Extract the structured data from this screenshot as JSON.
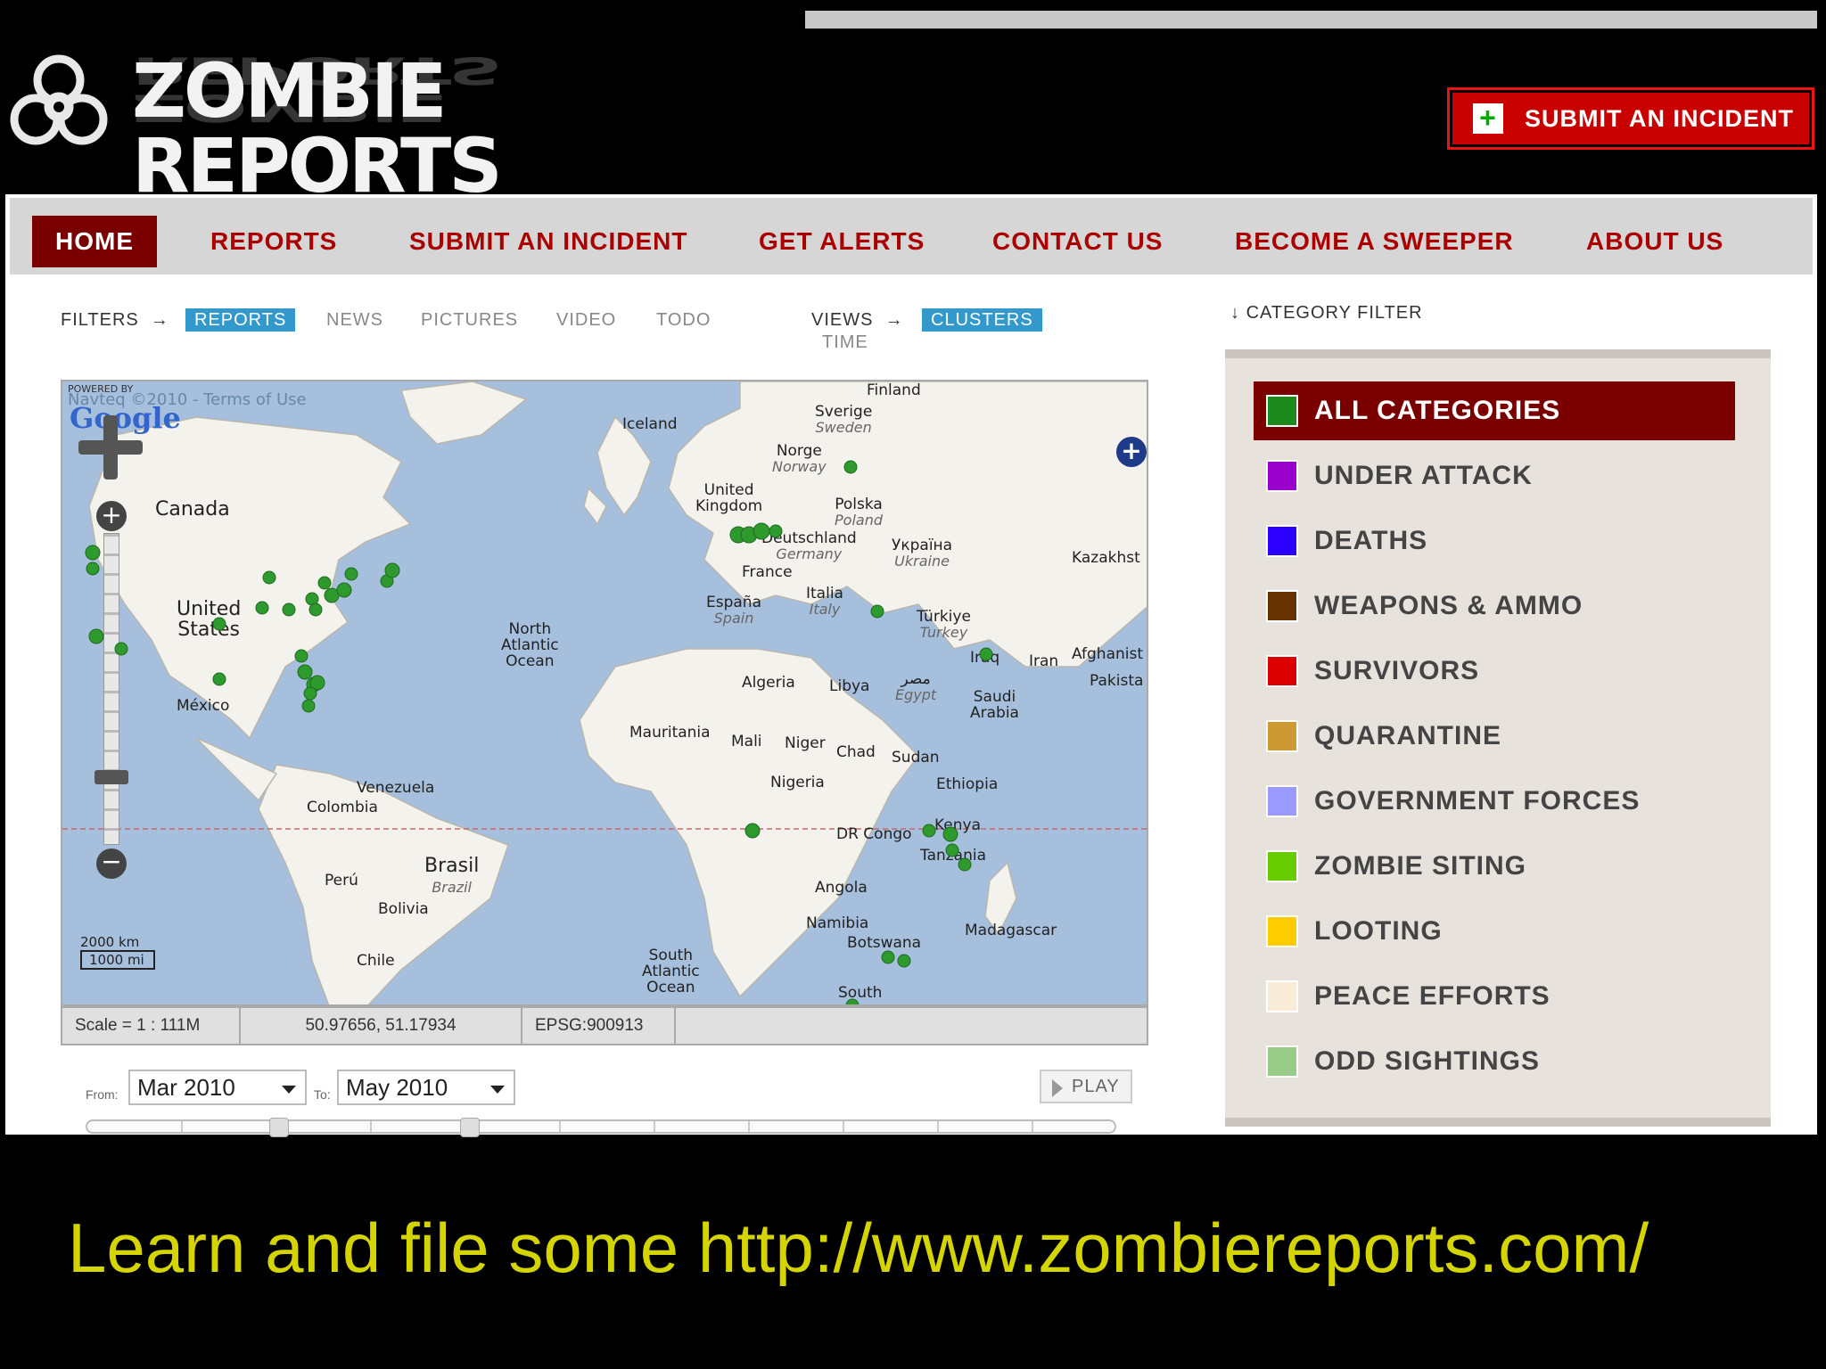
{
  "logo": {
    "text": "ZOMBIE REPORTS"
  },
  "header": {
    "submit_label": "SUBMIT AN INCIDENT"
  },
  "nav": {
    "items": [
      {
        "label": "HOME"
      },
      {
        "label": "REPORTS"
      },
      {
        "label": "SUBMIT AN INCIDENT"
      },
      {
        "label": "GET ALERTS"
      },
      {
        "label": "CONTACT US"
      },
      {
        "label": "BECOME A SWEEPER"
      },
      {
        "label": "ABOUT US"
      }
    ]
  },
  "filters": {
    "label": "FILTERS",
    "items": [
      "REPORTS",
      "NEWS",
      "PICTURES",
      "VIDEO",
      "TODO"
    ],
    "active": "REPORTS",
    "views_label": "VIEWS",
    "views": [
      "CLUSTERS",
      "TIME"
    ]
  },
  "map": {
    "attribution": "Navteq ©2010 - Terms of Use",
    "powered_by": "POWERED BY",
    "google": "Google",
    "labels": {
      "iceland": "Iceland",
      "finland": "Finland",
      "sverige": "Sverige",
      "sweden": "Sweden",
      "norge": "Norge",
      "norway": "Norway",
      "uk": "United\nKingdom",
      "polska": "Polska",
      "poland": "Poland",
      "deutschland": "Deutschland",
      "germany": "Germany",
      "ukraina": "Україна",
      "ukraine": "Ukraine",
      "france": "France",
      "kazakhstan": "Kazakhst",
      "espana": "España",
      "spain": "Spain",
      "italia": "Italia",
      "italy": "Italy",
      "turkiye": "Türkiye",
      "turkey": "Turkey",
      "iraq": "Iraq",
      "iran": "Iran",
      "afghanistan": "Afghanist",
      "pakistan": "Pakista",
      "canada": "Canada",
      "us": "United\nStates",
      "north_atlantic": "North\nAtlantic\nOcean",
      "algeria": "Algeria",
      "libya": "Libya",
      "egypt_ar": "مصر",
      "egypt": "Egypt",
      "saudi": "Saudi\nArabia",
      "mexico": "México",
      "mauritania": "Mauritania",
      "mali": "Mali",
      "niger": "Niger",
      "chad": "Chad",
      "sudan": "Sudan",
      "nigeria": "Nigeria",
      "ethiopia": "Ethiopia",
      "venezuela": "Venezuela",
      "colombia": "Colombia",
      "kenya": "Kenya",
      "drcongo": "DR Congo",
      "tanzania": "Tanzania",
      "brasil": "Brasil",
      "brazil": "Brazil",
      "peru": "Perú",
      "bolivia": "Bolivia",
      "angola": "Angola",
      "namibia": "Namibia",
      "botswana": "Botswana",
      "madagascar": "Madagascar",
      "chile": "Chile",
      "south_atlantic": "South\nAtlantic\nOcean",
      "south": "South"
    },
    "scale_km": "2000 km",
    "scale_mi": "1000 mi"
  },
  "status": {
    "scale": "Scale = 1 : 111M",
    "coords": "50.97656, 51.17934",
    "epsg": "EPSG:900913"
  },
  "timeline": {
    "from_label": "From:",
    "from_value": "Mar 2010",
    "to_label": "To:",
    "to_value": "May 2010",
    "play_label": "PLAY"
  },
  "category_filter": {
    "label": "CATEGORY FILTER",
    "items": [
      {
        "label": "ALL CATEGORIES",
        "color": "#1e8a1e"
      },
      {
        "label": "UNDER ATTACK",
        "color": "#9900cc"
      },
      {
        "label": "DEATHS",
        "color": "#2b00ff"
      },
      {
        "label": "WEAPONS & AMMO",
        "color": "#663300"
      },
      {
        "label": "SURVIVORS",
        "color": "#dd0000"
      },
      {
        "label": "QUARANTINE",
        "color": "#cc9933"
      },
      {
        "label": "GOVERNMENT FORCES",
        "color": "#9999ff"
      },
      {
        "label": "ZOMBIE SITING",
        "color": "#66cc00"
      },
      {
        "label": "LOOTING",
        "color": "#ffcc00"
      },
      {
        "label": "PEACE EFFORTS",
        "color": "#f8ecd8"
      },
      {
        "label": "ODD SIGHTINGS",
        "color": "#99cc88"
      }
    ]
  },
  "caption": "Learn and file some http://www.zombiereports.com/"
}
